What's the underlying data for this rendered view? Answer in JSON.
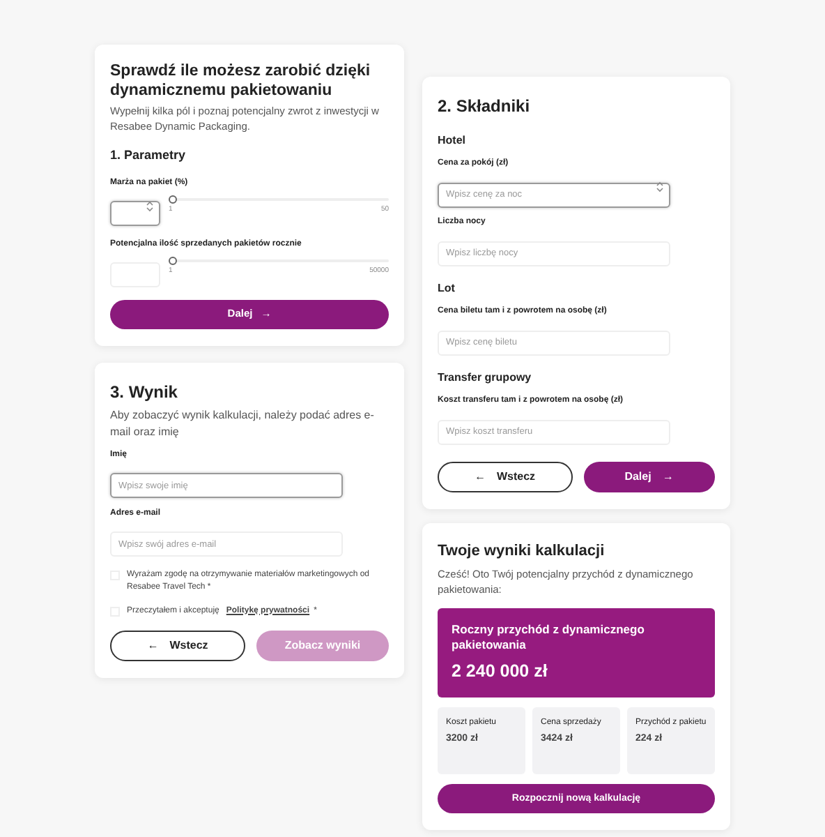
{
  "calculator": {
    "title": "Sprawdź ile możesz zarobić dzięki dynamicznemu pakietowaniu",
    "intro": "Wypełnij kilka pól i poznaj potencjalny zwrot z inwestycji w Resabee Dynamic Packaging.",
    "section": "1. Parametry",
    "sliders": [
      {
        "label": "Marża na pakiet (%)",
        "min": "1",
        "max": "50",
        "level": 0,
        "focused": true,
        "spinner": true
      },
      {
        "label": "Potencjalna ilość sprzedanych pakietów rocznie",
        "min": "1",
        "max": "50000",
        "level": 0,
        "focused": false,
        "spinner": false
      }
    ],
    "next": "Dalej",
    "next_arrow": "→"
  },
  "result_form": {
    "title": "3. Wynik",
    "intro": "Aby zobaczyć wynik kalkulacji, należy podać adres e-mail oraz imię",
    "fields": [
      {
        "label": "Imię",
        "placeholder": "Wpisz swoje imię",
        "focused": true
      },
      {
        "label": "Adres e-mail",
        "placeholder": "Wpisz swój adres e-mail",
        "focused": false
      }
    ],
    "consents": [
      {
        "text": "Wyrażam zgodę na otrzymywanie materiałów marketingowych od Resabee Travel Tech *",
        "checked": false
      },
      {
        "text": "Przeczytałem i akceptuję",
        "link": "Politykę prywatności",
        "suffix": "*",
        "checked": false
      }
    ],
    "back_arrow": "←",
    "back": "Wstecz",
    "submit": "Zobacz wyniki",
    "submit_disabled": true
  },
  "components": {
    "title": "2. Składniki",
    "groups": [
      {
        "heading": "Hotel",
        "fields": [
          {
            "label": "Cena za pokój (zł)",
            "placeholder": "Wpisz cenę za noc",
            "focused": true,
            "spinner": true
          },
          {
            "label": "Liczba nocy",
            "placeholder": "Wpisz liczbę nocy",
            "focused": false,
            "spinner": false
          }
        ]
      },
      {
        "heading": "Lot",
        "fields": [
          {
            "label": "Cena biletu tam i z powrotem na osobę (zł)",
            "placeholder": "Wpisz cenę biletu",
            "focused": false,
            "spinner": false
          }
        ]
      },
      {
        "heading": "Transfer grupowy",
        "fields": [
          {
            "label": "Koszt transferu tam i z powrotem na osobę (zł)",
            "placeholder": "Wpisz koszt transferu",
            "focused": false,
            "spinner": false
          }
        ]
      }
    ],
    "back_arrow": "←",
    "back": "Wstecz",
    "next": "Dalej",
    "next_arrow": "→"
  },
  "results": {
    "title": "Twoje wyniki kalkulacji",
    "intro": "Cześć! Oto Twój potencjalny przychód z dynamicznego pakietowania:",
    "headline_label": "Roczny przychód z dynamicznego pakietowania",
    "headline_value": "2 240 000 zł",
    "stats": [
      {
        "label": "Koszt pakietu",
        "value": "3200 zł"
      },
      {
        "label": "Cena sprzedaży",
        "value": "3424 zł"
      },
      {
        "label": "Przychód z pakietu",
        "value": "224 zł"
      }
    ],
    "restart": "Rozpocznij nową kalkulację"
  }
}
